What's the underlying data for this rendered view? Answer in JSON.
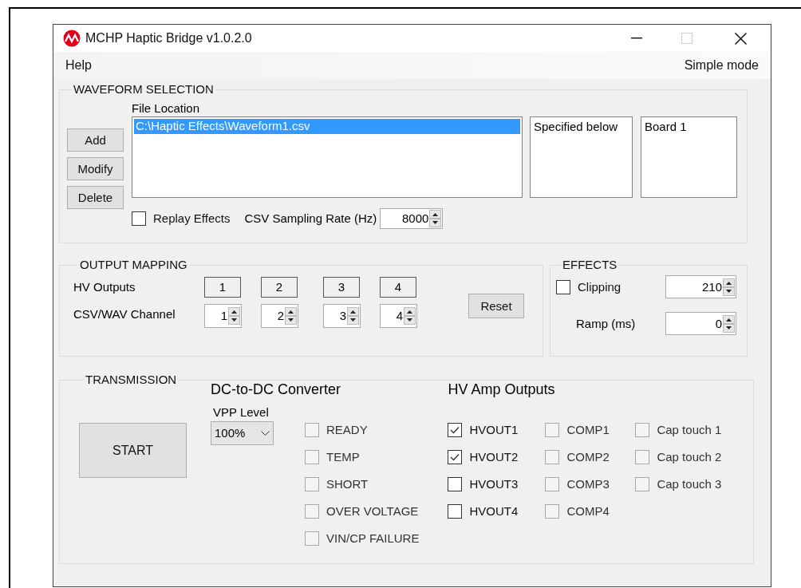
{
  "window": {
    "title": "MCHP Haptic Bridge v1.0.2.0",
    "maximize_disabled": true
  },
  "menu": [
    {
      "label": "Help"
    },
    {
      "label": "Simple mode"
    }
  ],
  "waveform_selection": {
    "title": "WAVEFORM SELECTION",
    "buttons": [
      "Add",
      "Modify",
      "Delete"
    ],
    "file_location_label": "File Location",
    "files": [
      {
        "path": "C:\\Haptic Effects\\Waveform1.csv",
        "selected": true
      }
    ],
    "list_2": [
      "Specified below"
    ],
    "list_3": [
      "Board 1"
    ],
    "replay": {
      "label": "Replay Effects",
      "checked": false
    },
    "sampling_rate": {
      "label": "CSV Sampling Rate (Hz)",
      "value": "8000"
    }
  },
  "output_mapping": {
    "title": "OUTPUT MAPPING",
    "hv_outputs_label": "HV Outputs",
    "channel_label": "CSV/WAV Channel",
    "mappings": [
      {
        "output": "1",
        "channel": "1"
      },
      {
        "output": "2",
        "channel": "2"
      },
      {
        "output": "3",
        "channel": "3"
      },
      {
        "output": "4",
        "channel": "4"
      }
    ],
    "reset": "Reset"
  },
  "effects": {
    "title": "EFFECTS",
    "clipping": {
      "label": "Clipping",
      "checked": false,
      "value": "210"
    },
    "ramp": {
      "label": "Ramp (ms)",
      "value": "0"
    }
  },
  "transmission": {
    "title": "TRANSMISSION",
    "start": "START",
    "dc_converter": {
      "title": "DC-to-DC Converter",
      "vpp_label": "VPP Level",
      "vpp_value": "100%",
      "flags": [
        {
          "label": "READY",
          "checked": false,
          "disabled": true
        },
        {
          "label": "TEMP",
          "checked": false,
          "disabled": true
        },
        {
          "label": "SHORT",
          "checked": false,
          "disabled": true
        },
        {
          "label": "OVER VOLTAGE",
          "checked": false,
          "disabled": true
        },
        {
          "label": "VIN/CP FAILURE",
          "checked": false,
          "disabled": true
        }
      ]
    },
    "hv_amp": {
      "title": "HV Amp Outputs",
      "columns": [
        {
          "items": [
            {
              "label": "HVOUT1",
              "checked": true,
              "disabled": false
            },
            {
              "label": "HVOUT2",
              "checked": true,
              "disabled": false
            },
            {
              "label": "HVOUT3",
              "checked": false,
              "disabled": false
            },
            {
              "label": "HVOUT4",
              "checked": false,
              "disabled": false
            }
          ]
        },
        {
          "items": [
            {
              "label": "COMP1",
              "checked": false,
              "disabled": true
            },
            {
              "label": "COMP2",
              "checked": false,
              "disabled": true
            },
            {
              "label": "COMP3",
              "checked": false,
              "disabled": true
            },
            {
              "label": "COMP4",
              "checked": false,
              "disabled": true
            }
          ]
        },
        {
          "items": [
            {
              "label": "Cap touch 1",
              "checked": false,
              "disabled": true
            },
            {
              "label": "Cap touch 2",
              "checked": false,
              "disabled": true
            },
            {
              "label": "Cap touch 3",
              "checked": false,
              "disabled": true
            }
          ]
        }
      ]
    }
  }
}
